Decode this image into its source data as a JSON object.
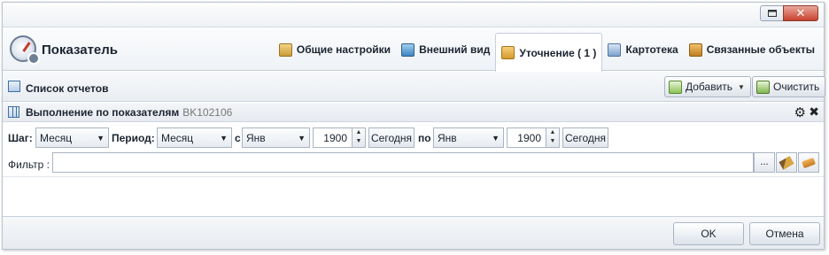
{
  "window": {
    "restore_icon": "restore-icon",
    "close_icon": "close-icon",
    "close_glyph": "✕"
  },
  "header": {
    "title": "Показатель",
    "tabs": [
      {
        "label": "Общие настройки",
        "icon": "settings-doc-icon"
      },
      {
        "label": "Внешний вид",
        "icon": "appearance-icon"
      },
      {
        "label": "Уточнение ( 1 )",
        "icon": "refine-icon",
        "active": true
      },
      {
        "label": "Картотека",
        "icon": "card-index-icon"
      },
      {
        "label": "Связанные объекты",
        "icon": "related-objects-icon"
      }
    ]
  },
  "reports": {
    "label": "Список отчетов",
    "add_label": "Добавить",
    "clear_label": "Очистить"
  },
  "panel": {
    "title": "Выполнение по показателям",
    "code": "BK102106"
  },
  "filters": {
    "step_label": "Шаг:",
    "step_value": "Месяц",
    "period_label": "Период:",
    "period_value": "Месяц",
    "from_label": "с",
    "from_month": "Янв",
    "from_year": "1900",
    "today_label": "Сегодня",
    "to_label": "по",
    "to_month": "Янв",
    "to_year": "1900",
    "today_label_2": "Сегодня",
    "filter_label": "Фильтр :",
    "filter_value": "",
    "ellipsis_label": "..."
  },
  "footer": {
    "ok_label": "OK",
    "cancel_label": "Отмена"
  },
  "colors": {
    "border": "#b9c3d0",
    "close_button": "#c8422e",
    "accent_blue": "#3f6ea6"
  }
}
